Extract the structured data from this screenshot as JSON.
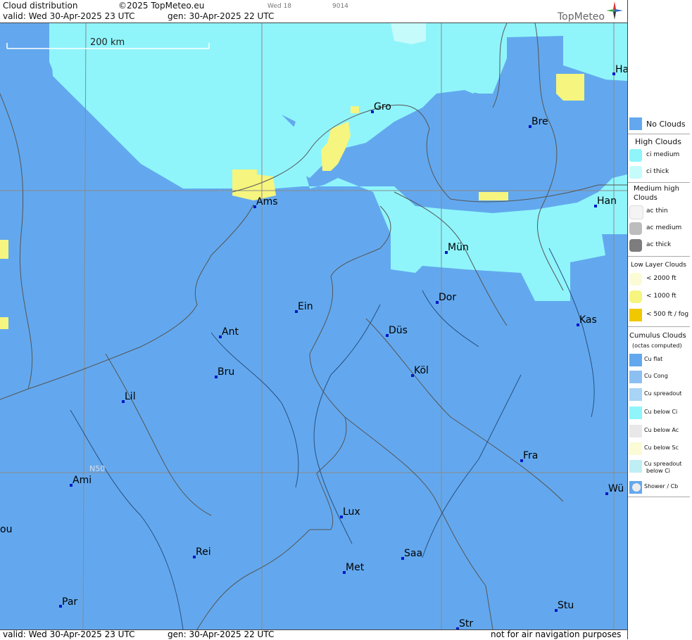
{
  "header": {
    "product": "Cloud distribution",
    "copyright": "©2025 TopMeteo.eu",
    "day_code": "Wed 18",
    "code": "9014",
    "valid": "valid:  Wed  30-Apr-2025  23 UTC",
    "gen": "gen:  30-Apr-2025 22 UTC",
    "brand": "TopMeteo"
  },
  "footer": {
    "valid": "valid:  Wed  30-Apr-2025  23 UTC",
    "gen": "gen: 30-Apr-2025 22 UTC",
    "disclaimer": "not for air navigation purposes"
  },
  "map": {
    "scale_label": "200 km",
    "lat_label": "N50",
    "cities": [
      {
        "name": "Ha"
      },
      {
        "name": "Gro"
      },
      {
        "name": "Bre"
      },
      {
        "name": "Ams"
      },
      {
        "name": "Han"
      },
      {
        "name": "Mün"
      },
      {
        "name": "Ein"
      },
      {
        "name": "Dor"
      },
      {
        "name": "Ant"
      },
      {
        "name": "Düs"
      },
      {
        "name": "Kas"
      },
      {
        "name": "Bru"
      },
      {
        "name": "Köl"
      },
      {
        "name": "Lil"
      },
      {
        "name": "Fra"
      },
      {
        "name": "Ami"
      },
      {
        "name": "Wü"
      },
      {
        "name": "Lux"
      },
      {
        "name": "ou"
      },
      {
        "name": "Rei"
      },
      {
        "name": "Saa"
      },
      {
        "name": "Met"
      },
      {
        "name": "Par"
      },
      {
        "name": "Stu"
      },
      {
        "name": "Str"
      }
    ]
  },
  "legend": {
    "no_clouds": "No Clouds",
    "high_title": "High Clouds",
    "ci_medium": "ci medium",
    "ci_thick": "ci thick",
    "medium_title_1": "Medium high",
    "medium_title_2": "Clouds",
    "ac_thin": "ac thin",
    "ac_medium": "ac medium",
    "ac_thick": "ac thick",
    "low_title": "Low Layer Clouds",
    "low_2000": "< 2000 ft",
    "low_1000": "< 1000 ft",
    "low_500": "< 500 ft / fog",
    "cu_title_1": "Cumulus Clouds",
    "cu_title_2": "(octas computed)",
    "cu_flat": "Cu flat",
    "cu_cong": "Cu Cong",
    "cu_spreadout": "Cu spreadout",
    "cu_below_ci": "Cu below Ci",
    "cu_below_ac": "Cu below Ac",
    "cu_below_sc": "Cu below Sc",
    "cu_spread_ci_1": "Cu spreadout",
    "cu_spread_ci_2": "below Ci",
    "shower": "Shower / Cb"
  },
  "colors": {
    "no_clouds": "#63a8ee",
    "ci_medium": "#8ff5fb",
    "ci_thick": "#c6fbfb",
    "low_1000": "#f5f57f",
    "low_500": "#f0c800",
    "city_marker": "#0018c8"
  }
}
